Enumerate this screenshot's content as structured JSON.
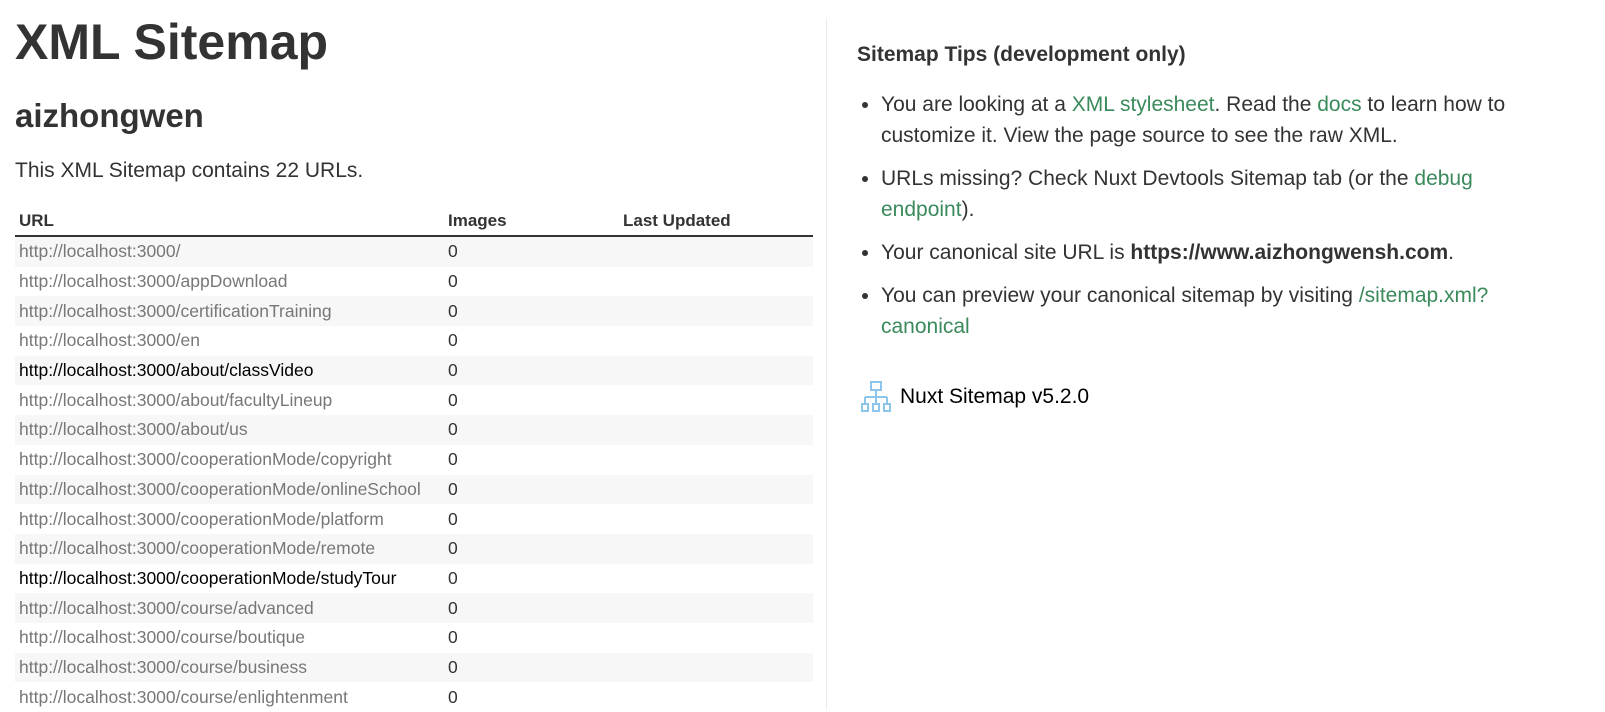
{
  "header": {
    "title": "XML Sitemap",
    "site_name": "aizhongwen",
    "summary": "This XML Sitemap contains 22 URLs."
  },
  "table": {
    "columns": [
      "URL",
      "Images",
      "Last Updated"
    ],
    "rows": [
      {
        "url": "http://localhost:3000/",
        "images": "0",
        "last_updated": "",
        "visited": false
      },
      {
        "url": "http://localhost:3000/appDownload",
        "images": "0",
        "last_updated": "",
        "visited": false
      },
      {
        "url": "http://localhost:3000/certificationTraining",
        "images": "0",
        "last_updated": "",
        "visited": false
      },
      {
        "url": "http://localhost:3000/en",
        "images": "0",
        "last_updated": "",
        "visited": false
      },
      {
        "url": "http://localhost:3000/about/classVideo",
        "images": "0",
        "last_updated": "",
        "visited": true
      },
      {
        "url": "http://localhost:3000/about/facultyLineup",
        "images": "0",
        "last_updated": "",
        "visited": false
      },
      {
        "url": "http://localhost:3000/about/us",
        "images": "0",
        "last_updated": "",
        "visited": false
      },
      {
        "url": "http://localhost:3000/cooperationMode/copyright",
        "images": "0",
        "last_updated": "",
        "visited": false
      },
      {
        "url": "http://localhost:3000/cooperationMode/onlineSchool",
        "images": "0",
        "last_updated": "",
        "visited": false
      },
      {
        "url": "http://localhost:3000/cooperationMode/platform",
        "images": "0",
        "last_updated": "",
        "visited": false
      },
      {
        "url": "http://localhost:3000/cooperationMode/remote",
        "images": "0",
        "last_updated": "",
        "visited": false
      },
      {
        "url": "http://localhost:3000/cooperationMode/studyTour",
        "images": "0",
        "last_updated": "",
        "visited": true
      },
      {
        "url": "http://localhost:3000/course/advanced",
        "images": "0",
        "last_updated": "",
        "visited": false
      },
      {
        "url": "http://localhost:3000/course/boutique",
        "images": "0",
        "last_updated": "",
        "visited": false
      },
      {
        "url": "http://localhost:3000/course/business",
        "images": "0",
        "last_updated": "",
        "visited": false
      },
      {
        "url": "http://localhost:3000/course/enlightenment",
        "images": "0",
        "last_updated": "",
        "visited": false
      }
    ]
  },
  "tips": {
    "title": "Sitemap Tips (development only)",
    "tip1": {
      "before": "You are looking at a ",
      "link1": "XML stylesheet",
      "mid": ". Read the ",
      "link2": "docs",
      "after": " to learn how to customize it. View the page source to see the raw XML."
    },
    "tip2": {
      "before": "URLs missing? Check Nuxt Devtools Sitemap tab (or the ",
      "link": "debug endpoint",
      "after": ")."
    },
    "tip3": {
      "before": "Your canonical site URL is ",
      "strong": "https://www.aizhongwensh.com",
      "after": "."
    },
    "tip4": {
      "before": "You can preview your canonical sitemap by visiting ",
      "link": "/sitemap.xml?canonical"
    }
  },
  "footer": {
    "version": "Nuxt Sitemap v5.2.0",
    "logo_icon": "sitemap-icon"
  },
  "colors": {
    "text": "#333333",
    "link_green": "#3a8a5c",
    "url_gray": "#777777",
    "url_visited": "#000000",
    "row_stripe": "#f7f7f7",
    "logo_blue": "#8ec5ec"
  }
}
